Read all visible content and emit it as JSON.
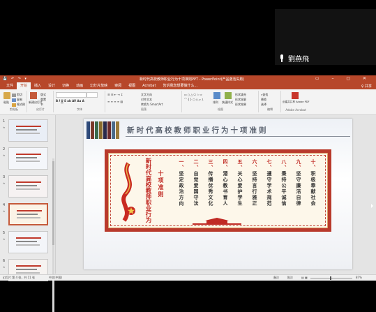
{
  "meeting": {
    "participant_name": "劉燕飛"
  },
  "window": {
    "title": "新时代高校教师职业行为十项准则PPT - PowerPoint(产品激活失败)",
    "quick_access": "💾 ↶ ↷ ▾"
  },
  "ribbon_tabs": [
    "文件",
    "开始",
    "插入",
    "设计",
    "切换",
    "动画",
    "幻灯片放映",
    "审阅",
    "视图",
    "Acrobat",
    "告诉我您想要做什么..."
  ],
  "active_tab_index": 1,
  "ribbon": {
    "clipboard": {
      "paste": "粘贴",
      "cut": "剪切",
      "copy": "复制",
      "format_painter": "格式刷",
      "label": "剪贴板"
    },
    "slides": {
      "new_slide": "新建幻灯片",
      "layout": "版式",
      "reset": "重置",
      "section": "节",
      "label": "幻灯片"
    },
    "font": {
      "label": "字体"
    },
    "paragraph": {
      "text_direction": "文字方向",
      "align_text": "对齐文本",
      "smartart": "转换为 SmartArt",
      "label": "段落"
    },
    "drawing": {
      "arrange": "排列",
      "quick_styles": "快速样式",
      "shape_fill": "形状填充",
      "shape_outline": "形状轮廓",
      "shape_effects": "形状效果",
      "label": "绘图"
    },
    "editing": {
      "find": "查找",
      "replace": "替换",
      "select": "选择",
      "label": "编辑"
    },
    "adobe": {
      "create_pdf": "创建并共享 Adobe PDF",
      "label": "Adobe Acrobat"
    }
  },
  "thumbnails": [
    {
      "num": "1",
      "title": "新时代高校教师职业行为十项准则"
    },
    {
      "num": "2",
      "title": ""
    },
    {
      "num": "3",
      "title": ""
    },
    {
      "num": "4",
      "title": ""
    },
    {
      "num": "5",
      "title": ""
    },
    {
      "num": "6",
      "title": ""
    }
  ],
  "selected_thumbnail": 3,
  "slide": {
    "title": "新时代高校教师职业行为十项准则",
    "vertical_title": "新时代高校教师职业行为",
    "vertical_sub": "十项准则",
    "rules": [
      {
        "num": "一、",
        "text": "坚定政治方向"
      },
      {
        "num": "二、",
        "text": "自觉爱国守法"
      },
      {
        "num": "三、",
        "text": "传播优秀文化"
      },
      {
        "num": "四、",
        "text": "潜心教书育人"
      },
      {
        "num": "五、",
        "text": "关心爱护学生"
      },
      {
        "num": "六、",
        "text": "坚持言行雅正"
      },
      {
        "num": "七、",
        "text": "遵守学术规范"
      },
      {
        "num": "八、",
        "text": "秉持公平诚信"
      },
      {
        "num": "九、",
        "text": "坚守廉洁自律"
      },
      {
        "num": "十、",
        "text": "积极奉献社会"
      }
    ]
  },
  "status": {
    "slide_info": "幻灯片 第 4 张，共 11 张",
    "language": "中文(中国)",
    "notes": "备注",
    "comments": "批注",
    "zoom": "87%"
  },
  "colors": {
    "accent": "#b7472a",
    "frame_red": "#b93a2c",
    "rule_red": "#c02a24"
  }
}
